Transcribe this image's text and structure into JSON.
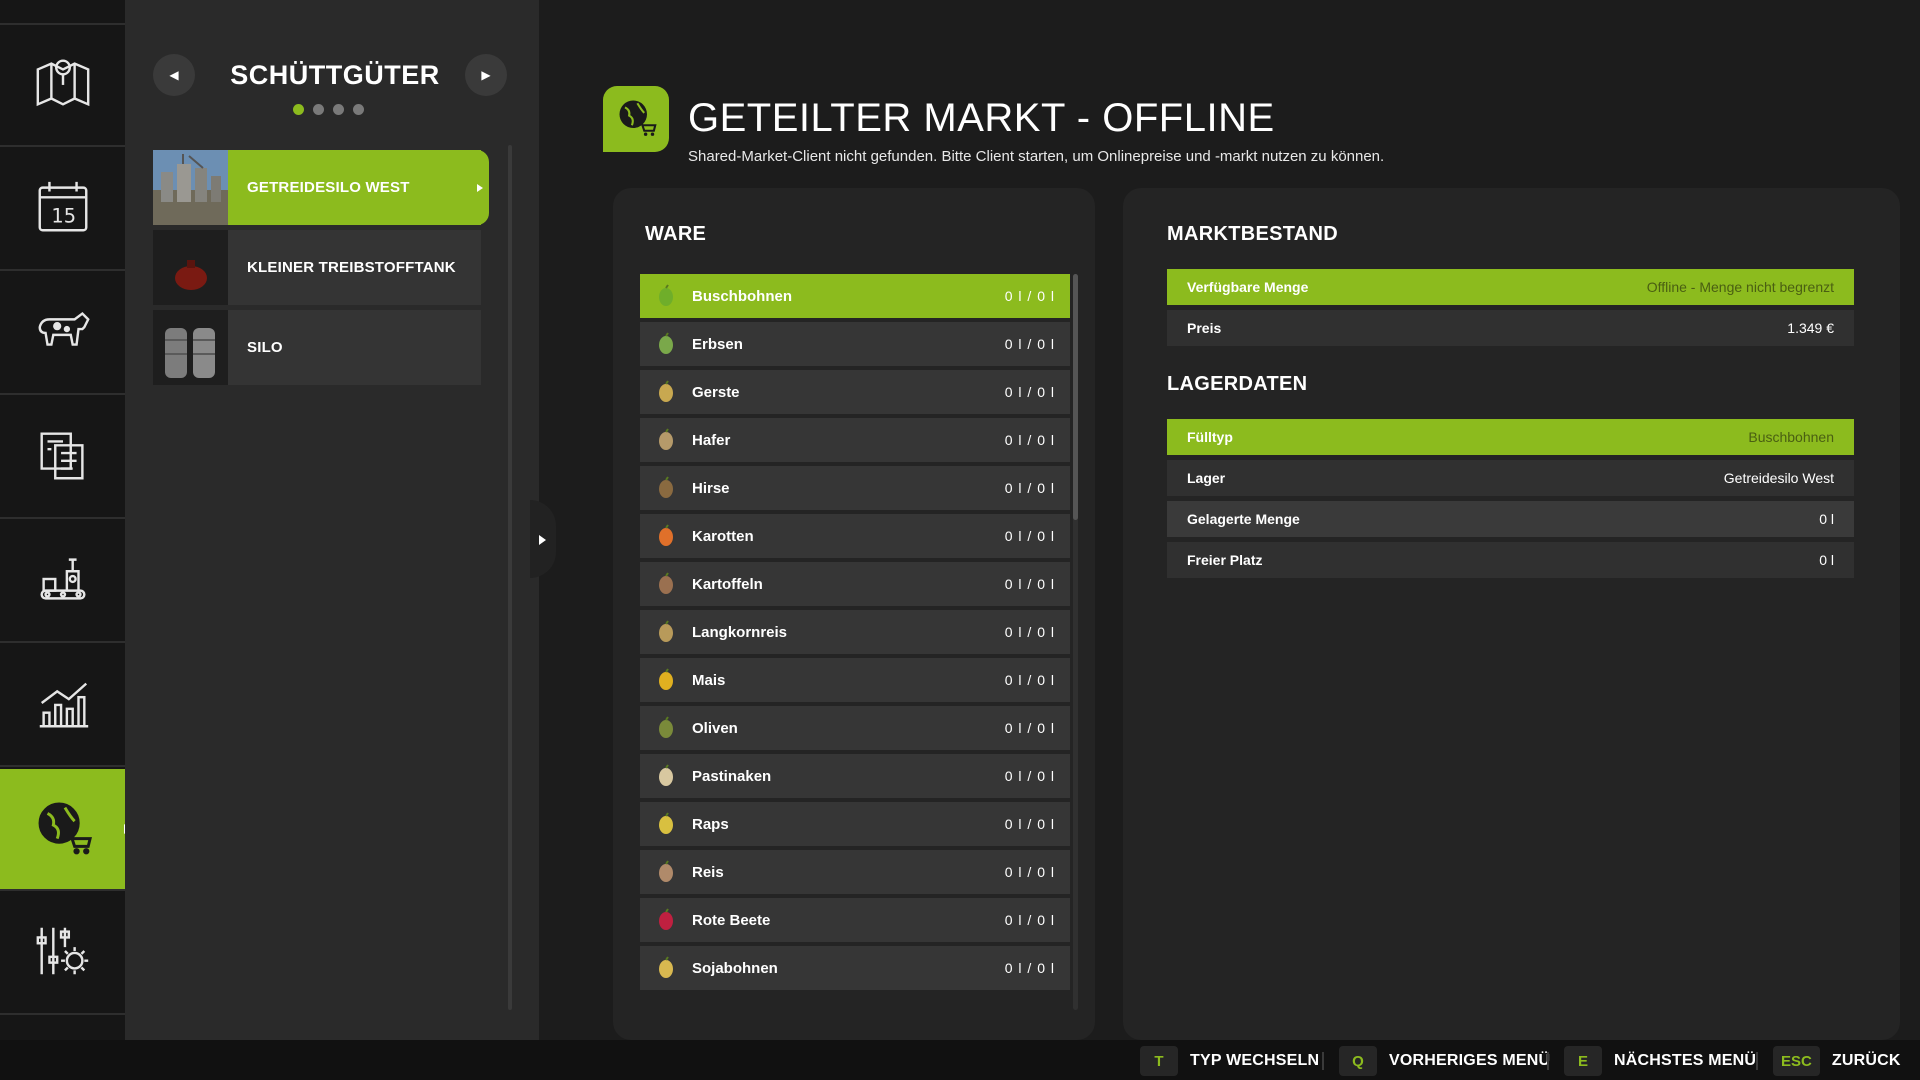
{
  "colors": {
    "accent": "#8cbb1e",
    "panel": "#2a2a2a",
    "row": "#363636"
  },
  "nav": {
    "items": [
      {
        "icon": "map-icon"
      },
      {
        "icon": "calendar-icon"
      },
      {
        "icon": "animals-icon"
      },
      {
        "icon": "contracts-icon"
      },
      {
        "icon": "production-icon"
      },
      {
        "icon": "statistics-icon"
      },
      {
        "icon": "shared-market-icon",
        "active": true
      },
      {
        "icon": "settings-icon"
      }
    ]
  },
  "left_panel": {
    "title": "SCHÜTTGÜTER",
    "page_dots": 4,
    "active_dot": 1,
    "items": [
      {
        "label": "GETREIDESILO WEST",
        "selected": true
      },
      {
        "label": "KLEINER TREIBSTOFFTANK"
      },
      {
        "label": "SILO"
      }
    ]
  },
  "main": {
    "title": "GETEILTER MARKT - OFFLINE",
    "subtitle": "Shared-Market-Client nicht gefunden. Bitte Client starten, um Onlinepreise und -markt nutzen zu können."
  },
  "ware": {
    "heading": "WARE",
    "items": [
      {
        "name": "Buschbohnen",
        "value": "0 l / 0 l",
        "selected": true,
        "icon": "green-beans-icon"
      },
      {
        "name": "Erbsen",
        "value": "0 l / 0 l",
        "icon": "peas-icon"
      },
      {
        "name": "Gerste",
        "value": "0 l / 0 l",
        "icon": "barley-icon"
      },
      {
        "name": "Hafer",
        "value": "0 l / 0 l",
        "icon": "oat-icon"
      },
      {
        "name": "Hirse",
        "value": "0 l / 0 l",
        "icon": "millet-icon"
      },
      {
        "name": "Karotten",
        "value": "0 l / 0 l",
        "icon": "carrot-icon"
      },
      {
        "name": "Kartoffeln",
        "value": "0 l / 0 l",
        "icon": "potato-icon"
      },
      {
        "name": "Langkornreis",
        "value": "0 l / 0 l",
        "icon": "long-grain-rice-icon"
      },
      {
        "name": "Mais",
        "value": "0 l / 0 l",
        "icon": "corn-icon"
      },
      {
        "name": "Oliven",
        "value": "0 l / 0 l",
        "icon": "olive-icon"
      },
      {
        "name": "Pastinaken",
        "value": "0 l / 0 l",
        "icon": "parsnip-icon"
      },
      {
        "name": "Raps",
        "value": "0 l / 0 l",
        "icon": "canola-icon"
      },
      {
        "name": "Reis",
        "value": "0 l / 0 l",
        "icon": "rice-icon"
      },
      {
        "name": "Rote Beete",
        "value": "0 l / 0 l",
        "icon": "beetroot-icon"
      },
      {
        "name": "Sojabohnen",
        "value": "0 l / 0 l",
        "icon": "soybean-icon"
      }
    ]
  },
  "marktbestand": {
    "heading": "MARKTBESTAND",
    "rows": [
      {
        "key": "Verfügbare Menge",
        "value": "Offline - Menge nicht begrenzt",
        "highlight": true
      },
      {
        "key": "Preis",
        "value": "1.349 €"
      }
    ]
  },
  "lagerdaten": {
    "heading": "LAGERDATEN",
    "rows": [
      {
        "key": "Fülltyp",
        "value": "Buschbohnen",
        "highlight": true
      },
      {
        "key": "Lager",
        "value": "Getreidesilo West"
      },
      {
        "key": "Gelagerte Menge",
        "value": "0 l"
      },
      {
        "key": "Freier Platz",
        "value": "0 l"
      }
    ]
  },
  "bottom_bar": {
    "hints": [
      {
        "key": "T",
        "label": "TYP WECHSELN"
      },
      {
        "key": "Q",
        "label": "VORHERIGES MENÜ"
      },
      {
        "key": "E",
        "label": "NÄCHSTES MENÜ"
      },
      {
        "key": "ESC",
        "label": "ZURÜCK"
      }
    ]
  }
}
